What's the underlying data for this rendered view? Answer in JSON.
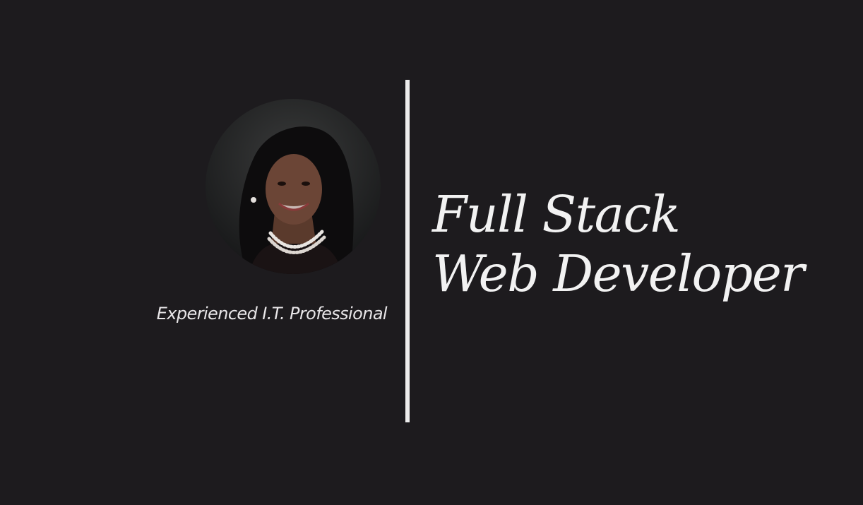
{
  "hero": {
    "tagline": "Experienced I.T. Professional",
    "headline_line1": "Full Stack",
    "headline_line2": "Web Developer",
    "avatar_alt": "Profile photo"
  },
  "colors": {
    "background": "#1d1b1e",
    "text": "#f2f2f2",
    "divider": "#ececec"
  }
}
